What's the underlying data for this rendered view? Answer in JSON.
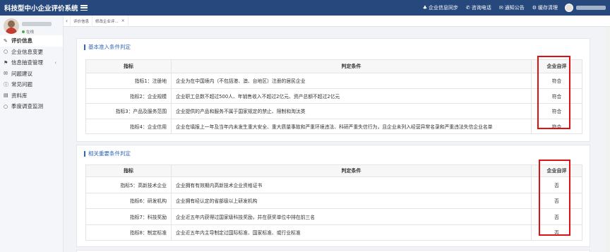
{
  "app": {
    "title": "科技型中小企业评价系统"
  },
  "topbar": {
    "links": [
      {
        "icon": "user-icon",
        "glyph": "♣",
        "label": "企业信息同步"
      },
      {
        "icon": "phone-icon",
        "glyph": "✆",
        "label": "咨询电话"
      },
      {
        "icon": "mail-icon",
        "glyph": "✉",
        "label": "通知公告"
      },
      {
        "icon": "gear-icon",
        "glyph": "⚙",
        "label": "缓存清理"
      }
    ]
  },
  "sidebar": {
    "status": "在线",
    "items": [
      {
        "label": "评价信息",
        "glyph": "✎",
        "active": true
      },
      {
        "label": "企业信息变更",
        "glyph": "○"
      },
      {
        "label": "信息抽查管理",
        "glyph": "⚑",
        "arrow": "‹"
      },
      {
        "label": "问题建议",
        "glyph": "✉"
      },
      {
        "label": "常见问题",
        "glyph": "ⓘ"
      },
      {
        "label": "资料库",
        "glyph": "▤"
      },
      {
        "label": "季度调查监测",
        "glyph": "○"
      }
    ]
  },
  "tabs": [
    {
      "label": "评价信息"
    },
    {
      "label": "修改企业评..."
    }
  ],
  "section1": {
    "title": "基本准入条件判定",
    "headers": [
      "指标",
      "判定条件",
      "企业自评"
    ],
    "rows": [
      {
        "indicator": "指标1：注册地",
        "condition": "企业为在中国境内（不包括港、澳、台地区）注册的居民企业",
        "result": "符合"
      },
      {
        "indicator": "指标2：企业规模",
        "condition": "企业职工总数不超过500人、年销售收入不超过2亿元、资产总额不超过2亿元",
        "result": "符合"
      },
      {
        "indicator": "指标3：产品及服务范围",
        "condition": "企业提供的产品和服务不属于国家规定的禁止、限制和淘汰类",
        "result": "符合"
      },
      {
        "indicator": "指标4：企业信用",
        "condition": "企业在填报上一年及当年内未发生重大安全、重大质量事故和严重环境违法、科研严重失信行为，且企业未列入经营异常名录和严重违法失信企业名单",
        "result": "符合"
      }
    ]
  },
  "section2": {
    "title": "相关重要条件判定",
    "headers": [
      "指标",
      "判定条件",
      "企业自评"
    ],
    "rows": [
      {
        "indicator": "指标5：高新技术企业",
        "condition": "企业拥有有效期内高新技术企业资格证书",
        "result": "否"
      },
      {
        "indicator": "指标6：研发机构",
        "condition": "企业拥有经认定的省部级以上研发机构",
        "result": "否"
      },
      {
        "indicator": "指标7：科技奖励",
        "condition": "企业近五年内获得过国家级科技奖励，并在获奖单位中排在前三名",
        "result": "否"
      },
      {
        "indicator": "指标8：制定标准",
        "condition": "企业近五年内主导制定过国际标准、国家标准、或行业标准",
        "result": "否"
      }
    ]
  }
}
